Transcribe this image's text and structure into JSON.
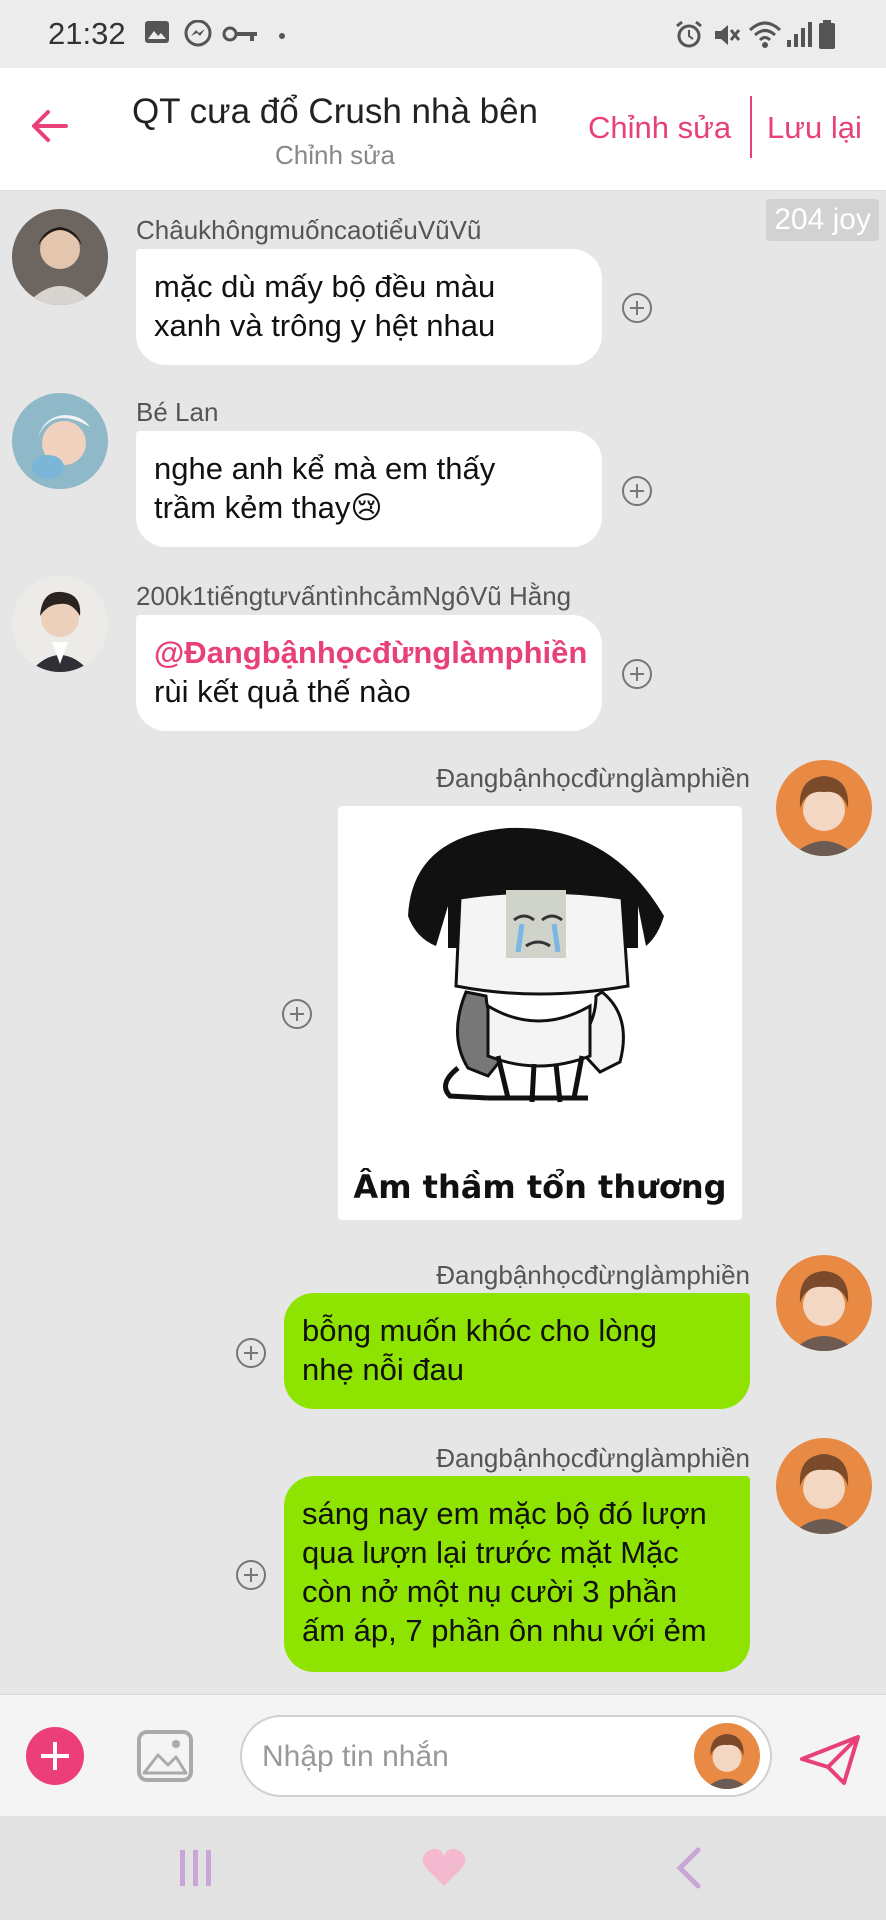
{
  "status_bar": {
    "time": "21:32",
    "icons": [
      "gallery-icon",
      "messenger-icon",
      "key-icon",
      "dot-icon",
      "alarm-icon",
      "mute-icon",
      "wifi-icon",
      "signal-icon",
      "battery-icon"
    ]
  },
  "header": {
    "title": "QT cưa đổ Crush nhà bên",
    "subtitle": "Chỉnh sửa",
    "edit_label": "Chỉnh sửa",
    "save_label": "Lưu lại",
    "accent_color": "#e8407b"
  },
  "chat": {
    "joy_badge": "204 joy",
    "messages": [
      {
        "direction": "incoming",
        "sender": "ChâukhôngmuốncaotiểuVũVũ",
        "lines": [
          "mặc dù mấy bộ đều màu",
          "xanh và trông y hệt nhau"
        ]
      },
      {
        "direction": "incoming",
        "sender": "Bé Lan",
        "lines": [
          "nghe anh kể mà em thấy",
          "trầm kẻm thay😢"
        ]
      },
      {
        "direction": "incoming",
        "sender": "200k1tiếngtưvấntìnhcảmNgôVũ Hằng",
        "mention": "@Đangbậnhọcđừnglàmphiền",
        "lines": [
          "rùi kết quả thế nào"
        ]
      },
      {
        "direction": "outgoing",
        "sender": "Đangbậnhọcđừnglàmphiền",
        "sticker_caption": "Âm thầm tổn thương"
      },
      {
        "direction": "outgoing",
        "sender": "Đangbậnhọcđừnglàmphiền",
        "lines": [
          "bỗng muốn khóc cho lòng",
          "nhẹ nỗi đau"
        ]
      },
      {
        "direction": "outgoing",
        "sender": "Đangbậnhọcđừnglàmphiền",
        "lines": [
          "sáng nay em mặc bộ đó lượn",
          "qua lượn lại trước mặt Mặc",
          "còn nở một nụ cười 3 phần",
          "ấm áp, 7 phần ôn nhu với ẻm"
        ]
      }
    ],
    "outgoing_bubble_color": "#8ee400",
    "incoming_bubble_color": "#ffffff"
  },
  "input_bar": {
    "placeholder": "Nhập tin nhắn"
  },
  "nav_bar": {
    "items": [
      "recent-apps-icon",
      "home-heart-icon",
      "back-icon"
    ]
  }
}
